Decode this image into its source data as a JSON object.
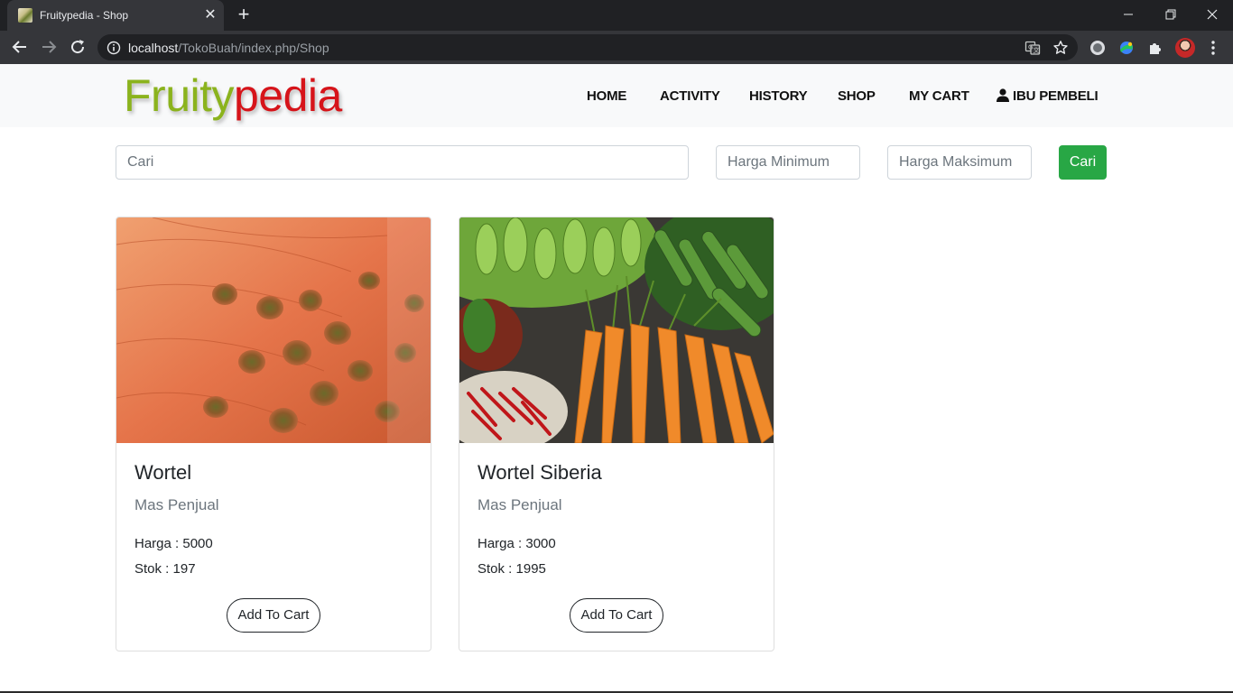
{
  "browser": {
    "tab_title": "Fruitypedia - Shop",
    "tab_close": "✕",
    "new_tab": "+",
    "url_host": "localhost",
    "url_path": "/TokoBuah/index.php/Shop"
  },
  "brand": {
    "part1": "Fruity",
    "part2": "pedia",
    "color1": "#8bb31d",
    "color2": "#d6141a"
  },
  "nav": {
    "home": "HOME",
    "activity": "ACTIVITY",
    "history": "HISTORY",
    "shop": "SHOP",
    "cart": "MY CART",
    "user": "IBU PEMBELI"
  },
  "filters": {
    "search_placeholder": "Cari",
    "min_placeholder": "Harga Minimum",
    "max_placeholder": "Harga Maksimum",
    "submit_label": "Cari",
    "submit_color": "#28a745"
  },
  "products": [
    {
      "name": "Wortel",
      "seller": "Mas Penjual",
      "price": "Harga : 5000",
      "stock": "Stok : 197",
      "button": "Add To Cart"
    },
    {
      "name": "Wortel Siberia",
      "seller": "Mas Penjual",
      "price": "Harga : 3000",
      "stock": "Stok : 1995",
      "button": "Add To Cart"
    }
  ]
}
